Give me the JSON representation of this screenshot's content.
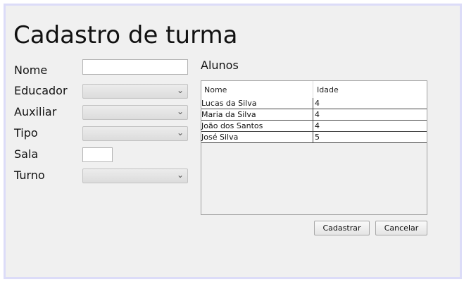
{
  "title": "Cadastro de turma",
  "form": {
    "nome_label": "Nome",
    "nome_value": "",
    "educador_label": "Educador",
    "educador_value": "",
    "auxiliar_label": "Auxiliar",
    "auxiliar_value": "",
    "tipo_label": "Tipo",
    "tipo_value": "",
    "sala_label": "Sala",
    "sala_value": "",
    "turno_label": "Turno",
    "turno_value": ""
  },
  "students": {
    "section_label": "Alunos",
    "columns": [
      "Nome",
      "Idade"
    ],
    "rows": [
      [
        "Lucas da Silva",
        "4"
      ],
      [
        "Maria da Silva",
        "4"
      ],
      [
        "João dos Santos",
        "4"
      ],
      [
        "José Silva",
        "5"
      ]
    ]
  },
  "buttons": {
    "cadastrar": "Cadastrar",
    "cancelar": "Cancelar"
  },
  "icons": {
    "dropdown": "chevron-down-icon"
  }
}
